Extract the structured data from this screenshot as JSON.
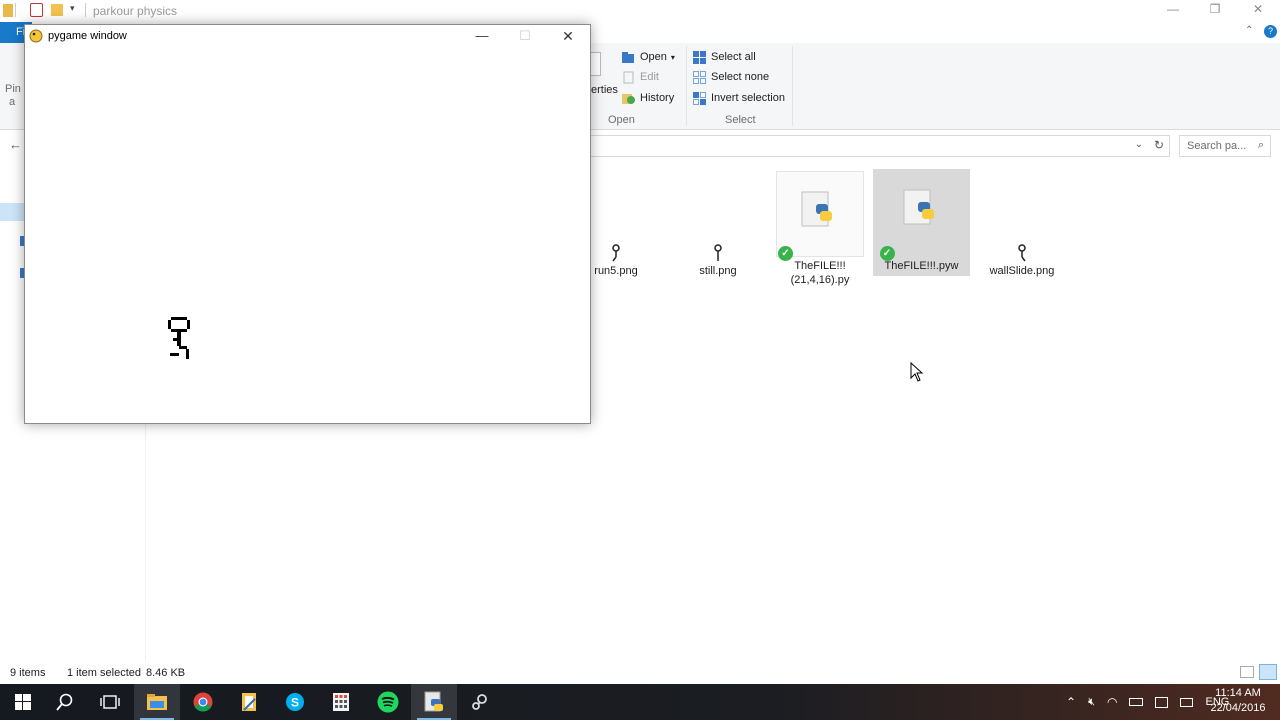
{
  "explorer": {
    "window_title": "parkour physics",
    "file_tab_label": "Fi",
    "pin_label_partial": "Pin",
    "pin_label_partial2": "a",
    "properties_partial": "erties",
    "ribbon": {
      "open_group": {
        "open_label": "Open",
        "edit_label": "Edit",
        "history_label": "History",
        "group_label": "Open"
      },
      "select_group": {
        "select_all_label": "Select all",
        "select_none_label": "Select none",
        "invert_selection_label": "Invert selection",
        "group_label": "Select"
      }
    },
    "search_placeholder": "Search pa...",
    "files": [
      {
        "name": "run5.png",
        "type": "png"
      },
      {
        "name": "still.png",
        "type": "png"
      },
      {
        "name_line1": "TheFILE!!!",
        "name_line2": "(21,4,16).py",
        "type": "py",
        "synced": true
      },
      {
        "name": "TheFILE!!!.pyw",
        "type": "pyw",
        "synced": true,
        "selected": true
      },
      {
        "name": "wallSlide.png",
        "type": "png"
      }
    ],
    "status": {
      "item_count": "9 items",
      "selection": "1 item selected",
      "size": "8.46 KB"
    }
  },
  "pygame_window": {
    "title": "pygame window"
  },
  "taskbar": {
    "apps": [
      "start-icon",
      "search-icon",
      "task-view-icon",
      "file-explorer-icon",
      "chrome-icon",
      "notepad-icon",
      "skype-icon",
      "calculator-icon",
      "spotify-icon",
      "python-icon",
      "steam-icon"
    ],
    "language": "ENG",
    "time": "11:14 AM",
    "date": "22/04/2016"
  },
  "colors": {
    "accent": "#1979ca",
    "selection": "#d9d9d9",
    "sync_check": "#38b44a"
  }
}
